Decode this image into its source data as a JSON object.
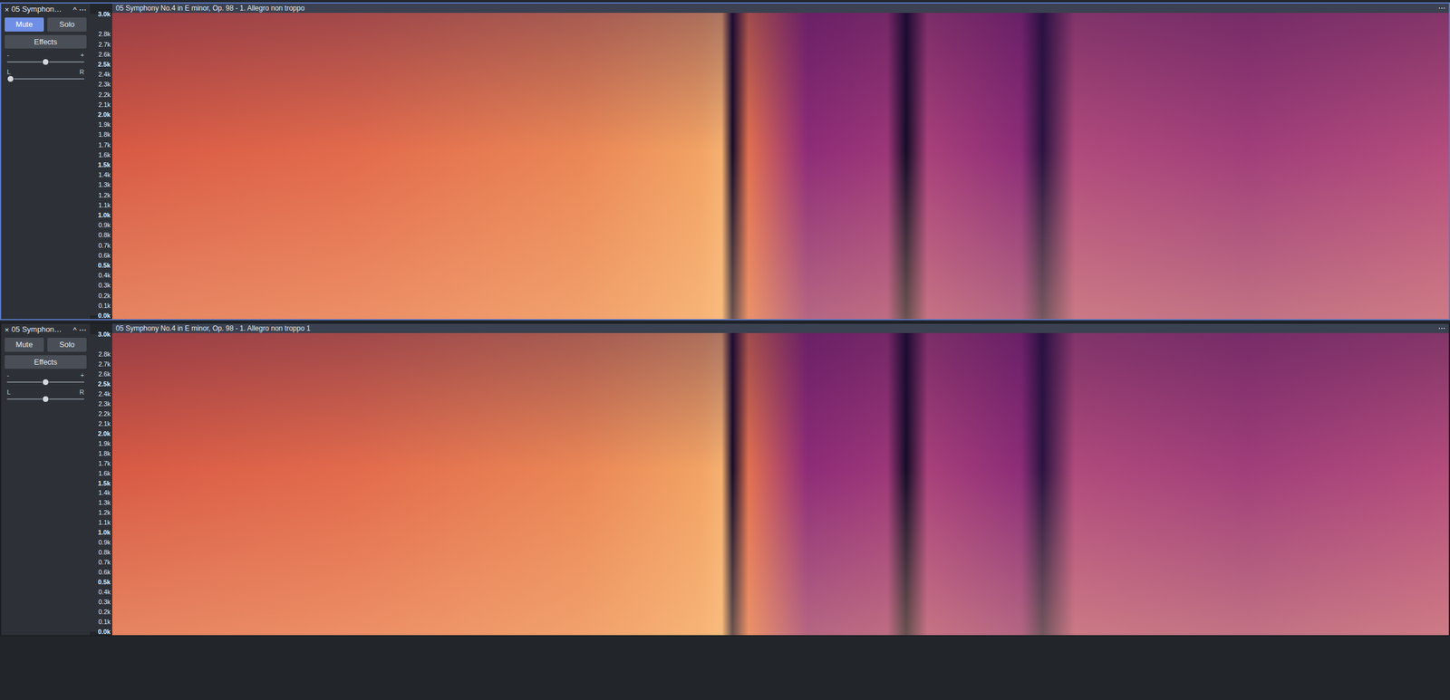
{
  "frequency_axis": [
    {
      "label": "3.0k",
      "major": true
    },
    {
      "label": "2.8k",
      "major": false
    },
    {
      "label": "2.7k",
      "major": false
    },
    {
      "label": "2.6k",
      "major": false
    },
    {
      "label": "2.5k",
      "major": true
    },
    {
      "label": "2.4k",
      "major": false
    },
    {
      "label": "2.3k",
      "major": false
    },
    {
      "label": "2.2k",
      "major": false
    },
    {
      "label": "2.1k",
      "major": false
    },
    {
      "label": "2.0k",
      "major": true
    },
    {
      "label": "1.9k",
      "major": false
    },
    {
      "label": "1.8k",
      "major": false
    },
    {
      "label": "1.7k",
      "major": false
    },
    {
      "label": "1.6k",
      "major": false
    },
    {
      "label": "1.5k",
      "major": true
    },
    {
      "label": "1.4k",
      "major": false
    },
    {
      "label": "1.3k",
      "major": false
    },
    {
      "label": "1.2k",
      "major": false
    },
    {
      "label": "1.1k",
      "major": false
    },
    {
      "label": "1.0k",
      "major": true
    },
    {
      "label": "0.9k",
      "major": false
    },
    {
      "label": "0.8k",
      "major": false
    },
    {
      "label": "0.7k",
      "major": false
    },
    {
      "label": "0.6k",
      "major": false
    },
    {
      "label": "0.5k",
      "major": true
    },
    {
      "label": "0.4k",
      "major": false
    },
    {
      "label": "0.3k",
      "major": false
    },
    {
      "label": "0.2k",
      "major": false
    },
    {
      "label": "0.1k",
      "major": false
    },
    {
      "label": "0.0k",
      "major": true
    }
  ],
  "tracks": [
    {
      "name": "05 Symphon…",
      "selected": true,
      "close": "×",
      "collapse": "^",
      "menu": "⋯",
      "buttons": [
        {
          "label": "Mute",
          "selected": true
        },
        {
          "label": "Solo",
          "selected": false
        }
      ],
      "effects": "Effects",
      "gain": {
        "min": "-",
        "max": "+",
        "level": 0.5
      },
      "pan": {
        "left": "L",
        "right": "R",
        "level": 0
      },
      "clip": {
        "title": "05 Symphony No.4 in E minor, Op. 98 - 1. Allegro non troppo",
        "menu": "⋯"
      }
    },
    {
      "name": "05 Symphon…",
      "selected": false,
      "close": "×",
      "collapse": "^",
      "menu": "⋯",
      "buttons": [
        {
          "label": "Mute",
          "selected": false
        },
        {
          "label": "Solo",
          "selected": false
        }
      ],
      "effects": "Effects",
      "gain": {
        "min": "-",
        "max": "+",
        "level": 0.5
      },
      "pan": {
        "left": "L",
        "right": "R",
        "level": 0.5
      },
      "clip": {
        "title": "05 Symphony No.4 in E minor, Op. 98 - 1. Allegro non troppo 1",
        "menu": "⋯"
      }
    }
  ]
}
